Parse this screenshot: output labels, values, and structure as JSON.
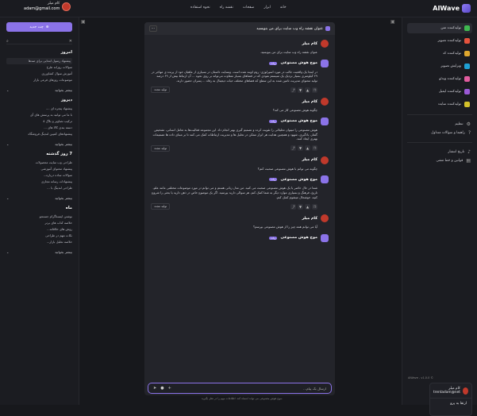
{
  "app": {
    "name": "AIWave"
  },
  "topnav": [
    "خانه",
    "ابزار",
    "صفحات",
    "نقشه راه",
    "نحوه استفاده"
  ],
  "user": {
    "name": "کام میلر",
    "email": "adam@gmail.com"
  },
  "right_sidebar": {
    "items": [
      {
        "label": "تولیدکننده متن",
        "color": "#3fb950",
        "active": true
      },
      {
        "label": "تولیدکننده تصویر",
        "color": "#e5533d",
        "badge": "جدید"
      },
      {
        "label": "تولیدکننده کد",
        "color": "#e0a82e"
      },
      {
        "label": "ویرایش تصویر",
        "color": "#1fa1d4"
      },
      {
        "label": "تولیدکننده ویدئو",
        "color": "#e25c9f"
      },
      {
        "label": "تولیدکننده ایمیل",
        "color": "#9b59d6"
      },
      {
        "label": "تولیدکننده سایت",
        "color": "#d4c12a"
      }
    ],
    "links1": [
      {
        "label": "تنظیم",
        "icon": "gear-icon"
      },
      {
        "label": "راهنما و سوالات متداول",
        "icon": "help-icon"
      }
    ],
    "links2": [
      {
        "label": "تاریخ انتشار",
        "icon": "bell-icon"
      },
      {
        "label": "قوانین و خط مشی",
        "icon": "doc-icon"
      }
    ],
    "version": "AiWave - v1.0.0 ©",
    "account": {
      "name": "کام میلر",
      "email": "trentadam@net",
      "action": "ارتقا به پرو"
    }
  },
  "left_sidebar": {
    "new_chat": "چت جدید",
    "groups": [
      {
        "title": "امروز",
        "items": [
          "پیشنهاد رسول ابتدایی برای صدها",
          "سوالات روزانه طرح",
          "آموزش سوال کشاورزی",
          "موضوعات روزهای فرعی بازار"
        ],
        "sel": 0
      },
      {
        "title": "دیروز",
        "items": [
          "پیشنهاد پنجره ای ....",
          "با ما می توانید به پرسش های آی",
          "ترکیب تصاویر و بلاگ 4",
          "دسته بندی کالا های ...",
          "پیشنهادهای کمپین لندینگ فروشگاه"
        ]
      },
      {
        "title": "7 روز گذشته",
        "items": [
          "طراحی وب سایت محصولات",
          "پیشنهاد محتوای آموزشی",
          "سوالات ساده درباره...",
          "پیشنهادات رسانه مجازی",
          "طراحی لندینگ با ..."
        ]
      },
      {
        "title": "ماه",
        "items": [
          "نوشتن اینستاگرام جستجو",
          "خلاصه کتاب های برتر",
          "روش های خلاقانه...",
          "نکات مهم در طراحی",
          "خلاصه تحلیل بازار..."
        ]
      }
    ],
    "more": "بیشتر بخوانید"
  },
  "chat": {
    "title": "عنوان نقشه راه وب سایت برای من بنویسید",
    "messages": [
      {
        "role": "user",
        "name": "کام میلر",
        "text": "عنوان نقشه راه وب سایت برای من بنویسید."
      },
      {
        "role": "bot",
        "name": "موج هوش مصنوعی",
        "badge": "ربات",
        "text": "در اینجا یک واقعیت جالب در مورد اسپرلوژی: روم اوپنه شده است. وبسایت داستان در بسیاری از ماهیان خود از پرنده ی مهاجر در ۲۹ کیلومتری بسیار نزدیک یک سیستم نفوذی که در فضاهای بسیار متفاوت می‌تواند بر روی نحوه ... آن ارتباط بیش از ۶۹ درصد تولید محتوای مدیریت تامین شده به این سطح که فضاهای مختلف حیات دیجیتال به رفاه ... پسران حضور دارند.",
        "regen": "تولید مجدد"
      },
      {
        "role": "user",
        "name": "کام میلر",
        "text": "چگونه هوش مصنوعی کار می کند؟"
      },
      {
        "role": "bot",
        "name": "موج هوش مصنوعی",
        "badge": "ربات",
        "text": "هوش مصنوعی را میتوان تحلیلاتی را تقویت کرده و تصمیم گیری بهتر انجام داد. این مجموعه فعالیت‌ها به تعامل انسانی، تشخیص گفتار، یادگیری، شهود و همچنین هدایت هر ابزار ممکن در تحلیل ها و مدیریت ارتباطات کمک می کنند تا بر مبنای داده ها تصمیمات بهتری ایجاد کنند.",
        "regen": "تولید مجدد"
      },
      {
        "role": "user",
        "name": "کام میلر",
        "text": "چگونه می توانم با هوش مصنوعی صحبت کنم؟"
      },
      {
        "role": "bot",
        "name": "موج هوش مصنوعی",
        "badge": "ربات",
        "text": "شما در حال حاضر با یک هوش مصنوعی صحبت می کنید. من مدل زبانی هستم و می توانم در مورد موضوعات مختلفی مانند علم، تاریخ، فرهنگ و بسیاری موارد دیگر به شما کمک کنم. هر سوالی دارید بپرسید. اگر یک موضوع خاص در ذهن دارید یا بحثی را شروع کنید، خوشحال میشوم کمک کنم.",
        "regen": "تولید مجدد"
      },
      {
        "role": "user",
        "name": "کام میلر",
        "text": "آیا می توانم همه چیز را از هوش مصنوعی بپرسم؟"
      },
      {
        "role": "bot",
        "name": "موج هوش مصنوعی",
        "badge": "ربات",
        "text": ""
      }
    ],
    "composer_placeholder": "ارسال یک پیام...",
    "footer": "موج هوش مصنوعی می تواند اشتباه کند. اطلاعات مهم را در نظر بگیرید."
  }
}
